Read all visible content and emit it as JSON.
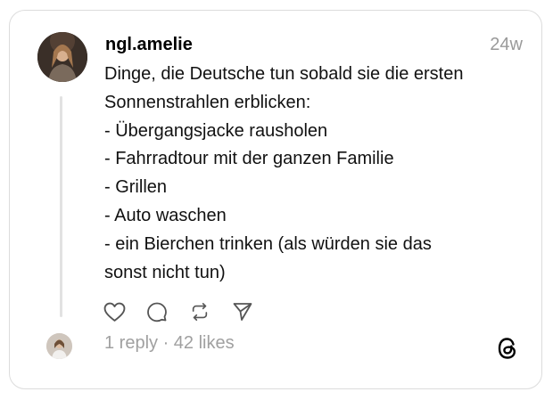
{
  "post": {
    "username": "ngl.amelie",
    "timestamp": "24w",
    "lines": [
      "Dinge, die Deutsche tun sobald sie die ersten",
      "Sonnenstrahlen erblicken:",
      "- Übergangsjacke rausholen",
      "- Fahrradtour mit der ganzen Familie",
      "- Grillen",
      "- Auto waschen",
      "- ein Bierchen trinken (als würden sie das",
      "sonst nicht tun)"
    ],
    "stats": "1 reply · 42 likes"
  },
  "icons": {
    "like": "heart-icon",
    "reply": "comment-icon",
    "repost": "repost-icon",
    "share": "send-icon",
    "brand": "threads-logo-icon"
  },
  "colors": {
    "border": "#dcdcdc",
    "muted": "#9a9a9a",
    "thread_line": "#e2e2e2",
    "text": "#111111"
  }
}
